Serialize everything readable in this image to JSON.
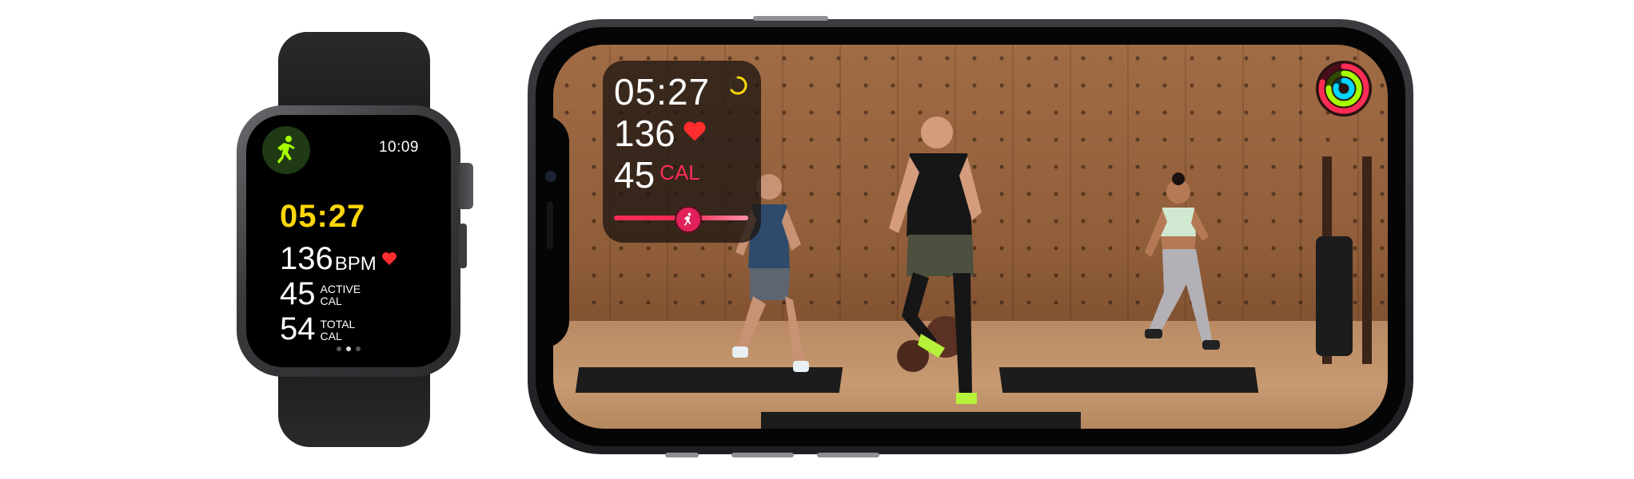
{
  "watch": {
    "clock": "10:09",
    "workout_icon": "running-figure-icon",
    "elapsed": "05:27",
    "heart_rate": "136",
    "heart_rate_unit": "BPM",
    "active_cal": "45",
    "active_label_1": "ACTIVE",
    "active_label_2": "CAL",
    "total_cal": "54",
    "total_label_1": "TOTAL",
    "total_label_2": "CAL",
    "page_indicator": {
      "pages": 3,
      "active": 2
    }
  },
  "phone": {
    "metrics": {
      "elapsed": "05:27",
      "heart_rate": "136",
      "calories": "45",
      "calories_unit": "CAL",
      "burn_bar_level": 0.54
    },
    "activity_rings_icon": "activity-rings-icon"
  },
  "colors": {
    "timer_yellow": "#ffd60a",
    "heart_red": "#ff2d2d",
    "cal_red": "#ff2d55",
    "move_ring": "#ff2d55",
    "exercise_ring": "#a6ff00",
    "stand_ring": "#00d4ff"
  }
}
